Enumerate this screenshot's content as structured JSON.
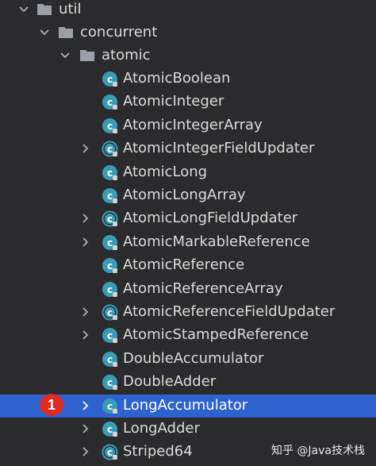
{
  "tree": {
    "folders": [
      {
        "label": "util",
        "icon": "folder-icon",
        "expanded": true
      },
      {
        "label": "concurrent",
        "icon": "folder-icon",
        "expanded": true
      },
      {
        "label": "atomic",
        "icon": "folder-icon",
        "expanded": true
      }
    ],
    "classes": [
      {
        "label": "AtomicBoolean",
        "expandable": false,
        "selected": false,
        "icon": "class-icon"
      },
      {
        "label": "AtomicInteger",
        "expandable": false,
        "selected": false,
        "icon": "class-icon"
      },
      {
        "label": "AtomicIntegerArray",
        "expandable": false,
        "selected": false,
        "icon": "class-icon"
      },
      {
        "label": "AtomicIntegerFieldUpdater",
        "expandable": true,
        "selected": false,
        "icon": "abstract-class-icon"
      },
      {
        "label": "AtomicLong",
        "expandable": false,
        "selected": false,
        "icon": "class-icon"
      },
      {
        "label": "AtomicLongArray",
        "expandable": false,
        "selected": false,
        "icon": "class-icon"
      },
      {
        "label": "AtomicLongFieldUpdater",
        "expandable": true,
        "selected": false,
        "icon": "abstract-class-icon"
      },
      {
        "label": "AtomicMarkableReference",
        "expandable": true,
        "selected": false,
        "icon": "class-icon"
      },
      {
        "label": "AtomicReference",
        "expandable": false,
        "selected": false,
        "icon": "class-icon"
      },
      {
        "label": "AtomicReferenceArray",
        "expandable": false,
        "selected": false,
        "icon": "class-icon"
      },
      {
        "label": "AtomicReferenceFieldUpdater",
        "expandable": true,
        "selected": false,
        "icon": "abstract-class-icon"
      },
      {
        "label": "AtomicStampedReference",
        "expandable": true,
        "selected": false,
        "icon": "class-icon"
      },
      {
        "label": "DoubleAccumulator",
        "expandable": false,
        "selected": false,
        "icon": "class-icon"
      },
      {
        "label": "DoubleAdder",
        "expandable": false,
        "selected": false,
        "icon": "class-icon"
      },
      {
        "label": "LongAccumulator",
        "expandable": true,
        "selected": true,
        "icon": "class-icon"
      },
      {
        "label": "LongAdder",
        "expandable": true,
        "selected": false,
        "icon": "class-icon"
      },
      {
        "label": "Striped64",
        "expandable": true,
        "selected": false,
        "icon": "abstract-class-icon"
      }
    ]
  },
  "annotation": {
    "badge_number": "1"
  },
  "watermark": "知乎 @Java技术栈",
  "colors": {
    "background": "#2b2b2d",
    "selection": "#2e62cf",
    "class_icon": "#3a9bb5",
    "folder": "#9aa0a6",
    "badge": "#e02a24"
  }
}
